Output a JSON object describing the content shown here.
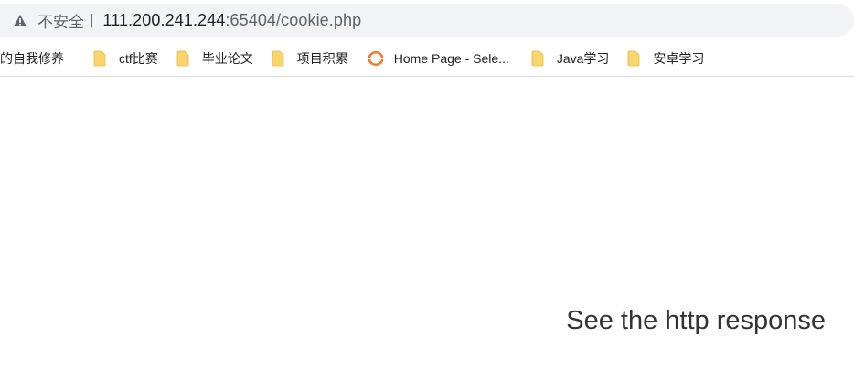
{
  "address_bar": {
    "security_label": "不安全",
    "divider": "|",
    "url_host": "111.200.241.244",
    "url_rest": ":65404/cookie.php"
  },
  "bookmarks": [
    {
      "label": "的自我修养",
      "icon": "none"
    },
    {
      "label": "ctf比赛",
      "icon": "folder-icon"
    },
    {
      "label": "毕业论文",
      "icon": "folder-icon"
    },
    {
      "label": "项目积累",
      "icon": "folder-icon"
    },
    {
      "label": "Home Page - Sele...",
      "icon": "selenium-spinner-icon"
    },
    {
      "label": "Java学习",
      "icon": "folder-icon"
    },
    {
      "label": "安卓学习",
      "icon": "folder-icon"
    }
  ],
  "page": {
    "message": "See the http response"
  },
  "colors": {
    "folder": "#f9d56e",
    "spinner": "#ee7d2b",
    "address_bg": "#f1f3f4",
    "text": "#202124",
    "muted": "#5f6368"
  }
}
